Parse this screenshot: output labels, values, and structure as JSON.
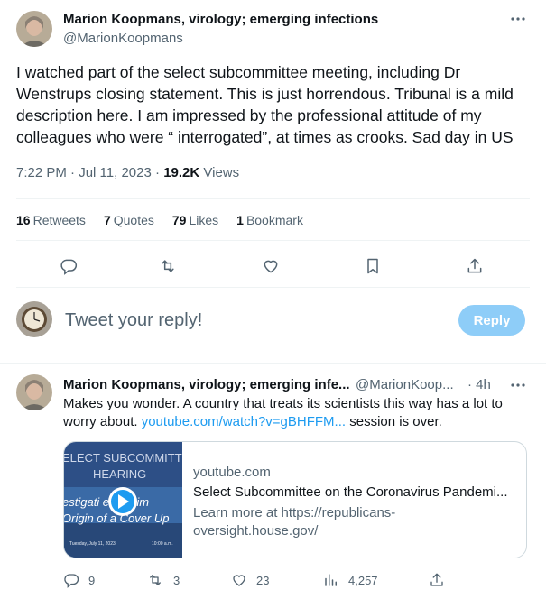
{
  "tweet": {
    "author_name": "Marion Koopmans, virology; emerging infections",
    "author_handle": "@MarionKoopmans",
    "text": "I watched part of the select subcommittee meeting, including Dr Wenstrups closing statement.  This is just horrendous. Tribunal is a mild description here. I am impressed by the professional attitude of my colleagues who were “ interrogated”, at times as crooks. Sad day in US",
    "time": "7:22 PM",
    "date": "Jul 11, 2023",
    "views_count": "19.2K",
    "views_label": "Views",
    "stats": [
      {
        "count": "16",
        "label": "Retweets"
      },
      {
        "count": "7",
        "label": "Quotes"
      },
      {
        "count": "79",
        "label": "Likes"
      },
      {
        "count": "1",
        "label": "Bookmark"
      }
    ],
    "actions": [
      "reply-icon",
      "retweet-icon",
      "like-icon",
      "bookmark-icon",
      "share-icon"
    ]
  },
  "composer": {
    "placeholder": "Tweet your reply!",
    "reply_button": "Reply"
  },
  "reply": {
    "author_name": "Marion Koopmans, virology; emerging infe...",
    "author_handle": "@MarionKoop...",
    "time": "· 4h",
    "text_before": "Makes you wonder. A country that treats its scientists this way has a lot to worry about. ",
    "link": "youtube.com/watch?v=gBHFFM...",
    "text_after": " session is over.",
    "card": {
      "thumb_line1": "ELECT SUBCOMMITTE",
      "thumb_line2": "HEARING",
      "thumb_line3": "estigati   e Proxim",
      "thumb_line4": "Origin of a Cover Up",
      "thumb_date": "Tuesday, July 11, 2023",
      "thumb_time": "10:00 a.m.",
      "domain": "youtube.com",
      "title": "Select Subcommittee on the Coronavirus Pandemi...",
      "description": "Learn more at https://republicans-oversight.house.gov/"
    },
    "counts": {
      "replies": "9",
      "retweets": "3",
      "likes": "23",
      "views": "4,257"
    }
  },
  "colors": {
    "accent": "#1d9bf0",
    "reply_button_disabled": "#8ecdf8",
    "muted_text": "#536471",
    "divider": "#eff3f4"
  }
}
